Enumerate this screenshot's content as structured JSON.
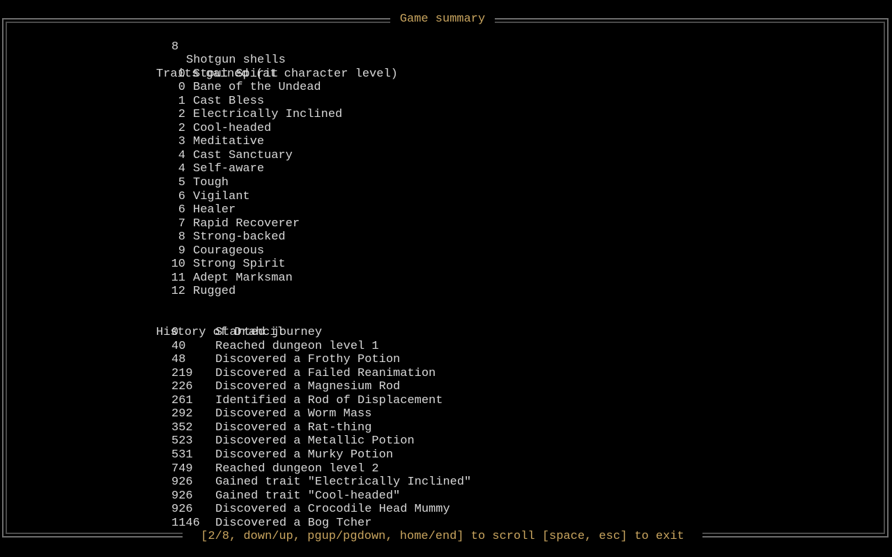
{
  "window": {
    "title": "Game summary",
    "footer": "[2/8, down/up, pgup/pgdown, home/end] to scroll [space, esc] to exit"
  },
  "colors": {
    "background": "#000000",
    "text": "#d8d8d8",
    "accent": "#c9a55f",
    "frame": "#6e6e6e"
  },
  "inventory_tail": {
    "count": "8",
    "item": "Shotgun shells"
  },
  "traits": {
    "heading": "Traits gained (at character level)",
    "items": [
      {
        "level": "0",
        "name": "Stout Spirit"
      },
      {
        "level": "0",
        "name": "Bane of the Undead"
      },
      {
        "level": "1",
        "name": "Cast Bless"
      },
      {
        "level": "2",
        "name": "Electrically Inclined"
      },
      {
        "level": "2",
        "name": "Cool-headed"
      },
      {
        "level": "3",
        "name": "Meditative"
      },
      {
        "level": "4",
        "name": "Cast Sanctuary"
      },
      {
        "level": "4",
        "name": "Self-aware"
      },
      {
        "level": "5",
        "name": "Tough"
      },
      {
        "level": "6",
        "name": "Vigilant"
      },
      {
        "level": "6",
        "name": "Healer"
      },
      {
        "level": "7",
        "name": "Rapid Recoverer"
      },
      {
        "level": "8",
        "name": "Strong-backed"
      },
      {
        "level": "9",
        "name": "Courageous"
      },
      {
        "level": "10",
        "name": "Strong Spirit"
      },
      {
        "level": "11",
        "name": "Adept Marksman"
      },
      {
        "level": "12",
        "name": "Rugged"
      }
    ]
  },
  "history": {
    "heading": "History of Drahcil",
    "items": [
      {
        "turn": "0",
        "event": "Started journey"
      },
      {
        "turn": "40",
        "event": "Reached dungeon level 1"
      },
      {
        "turn": "48",
        "event": "Discovered a Frothy Potion"
      },
      {
        "turn": "219",
        "event": "Discovered a Failed Reanimation"
      },
      {
        "turn": "226",
        "event": "Discovered a Magnesium Rod"
      },
      {
        "turn": "261",
        "event": "Identified a Rod of Displacement"
      },
      {
        "turn": "292",
        "event": "Discovered a Worm Mass"
      },
      {
        "turn": "352",
        "event": "Discovered a Rat-thing"
      },
      {
        "turn": "523",
        "event": "Discovered a Metallic Potion"
      },
      {
        "turn": "531",
        "event": "Discovered a Murky Potion"
      },
      {
        "turn": "749",
        "event": "Reached dungeon level 2"
      },
      {
        "turn": "926",
        "event": "Gained trait \"Electrically Inclined\""
      },
      {
        "turn": "926",
        "event": "Gained trait \"Cool-headed\""
      },
      {
        "turn": "926",
        "event": "Discovered a Crocodile Head Mummy"
      },
      {
        "turn": "1146",
        "event": "Discovered a Bog Tcher"
      }
    ]
  }
}
